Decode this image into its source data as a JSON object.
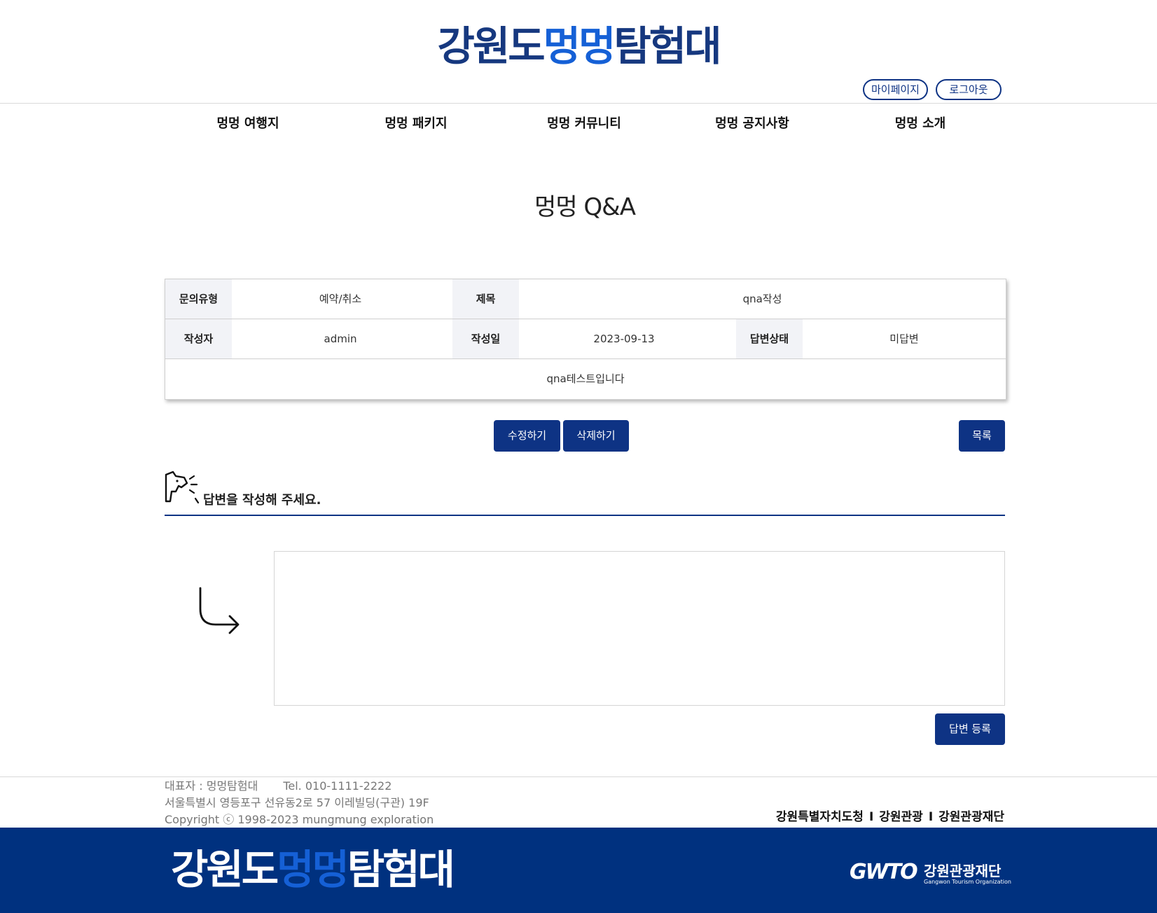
{
  "header": {
    "logo": {
      "part1": "강원도",
      "part2": "멍멍",
      "part3": "탐험대"
    },
    "mypage_label": "마이페이지",
    "logout_label": "로그아웃"
  },
  "nav": {
    "items": [
      {
        "label": "멍멍 여행지"
      },
      {
        "label": "멍멍 패키지"
      },
      {
        "label": "멍멍 커뮤니티"
      },
      {
        "label": "멍멍 공지사항"
      },
      {
        "label": "멍멍 소개"
      }
    ]
  },
  "page": {
    "title": "멍멍 Q&A"
  },
  "detail": {
    "type_label": "문의유형",
    "type_value": "예약/취소",
    "subject_label": "제목",
    "subject_value": "qna작성",
    "author_label": "작성자",
    "author_value": "admin",
    "date_label": "작성일",
    "date_value": "2023-09-13",
    "status_label": "답변상태",
    "status_value": "미답변",
    "content": "qna테스트입니다"
  },
  "actions": {
    "edit_label": "수정하기",
    "delete_label": "삭제하기",
    "list_label": "목록"
  },
  "answer": {
    "heading": "답변을 작성해 주세요.",
    "textarea_value": "",
    "submit_label": "답변 등록"
  },
  "footer": {
    "representative": "대표자 : 멍멍탐험대",
    "tel": "Tel. 010-1111-2222",
    "address": "서울특별시 영등포구 선유동2로 57 이레빌딩(구관) 19F",
    "copyright": "Copyright ⓒ 1998-2023 mungmung exploration",
    "links": [
      "강원특별자치도청",
      "강원관광",
      "강원관광재단"
    ],
    "separator": "I",
    "logo": {
      "part1": "강원도",
      "part2": "멍멍",
      "part3": "탐험대"
    },
    "partner_mark": "GWTO",
    "partner_name": "강원관광재단",
    "partner_sub": "Gangwon Tourism Organization"
  },
  "colors": {
    "brand_navy": "#0e3384",
    "brand_blue": "#1560d6",
    "footer_bar": "#00317f",
    "table_header_bg": "#f2f3f7"
  },
  "icons": [
    "dog-megaphone-icon",
    "curved-arrow-icon",
    "gwto-logo-icon"
  ]
}
